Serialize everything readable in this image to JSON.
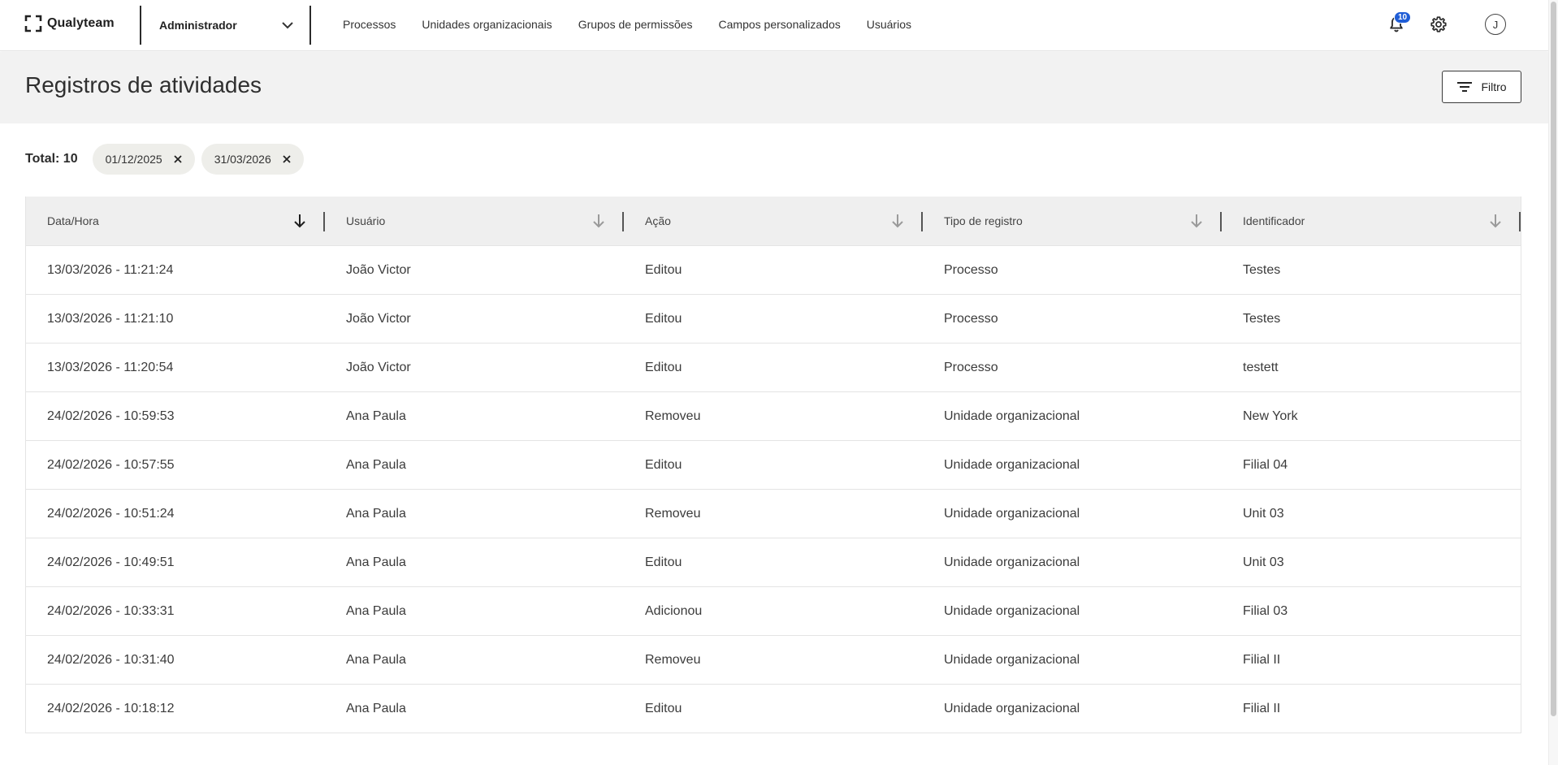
{
  "brand": {
    "name": "Qualyteam"
  },
  "role_select": {
    "value": "Administrador"
  },
  "nav": {
    "items": [
      {
        "label": "Processos"
      },
      {
        "label": "Unidades organizacionais"
      },
      {
        "label": "Grupos de permissões"
      },
      {
        "label": "Campos personalizados"
      },
      {
        "label": "Usuários"
      }
    ]
  },
  "notifications": {
    "count": "10",
    "icon": "bell-icon"
  },
  "settings": {
    "icon": "gear-icon"
  },
  "user": {
    "initial": "J"
  },
  "page": {
    "title": "Registros de atividades"
  },
  "filter_button": {
    "label": "Filtro"
  },
  "summary": {
    "total_label": "Total: 10"
  },
  "chips": [
    {
      "label": "01/12/2025"
    },
    {
      "label": "31/03/2026"
    }
  ],
  "table": {
    "columns": [
      {
        "label": "Data/Hora",
        "active_sort": true
      },
      {
        "label": "Usuário",
        "active_sort": false
      },
      {
        "label": "Ação",
        "active_sort": false
      },
      {
        "label": "Tipo de registro",
        "active_sort": false
      },
      {
        "label": "Identificador",
        "active_sort": false
      }
    ],
    "rows": [
      [
        "13/03/2026 - 11:21:24",
        "João Victor",
        "Editou",
        "Processo",
        "Testes"
      ],
      [
        "13/03/2026 - 11:21:10",
        "João Victor",
        "Editou",
        "Processo",
        "Testes"
      ],
      [
        "13/03/2026 - 11:20:54",
        "João Victor",
        "Editou",
        "Processo",
        "testett"
      ],
      [
        "24/02/2026 - 10:59:53",
        "Ana Paula",
        "Removeu",
        "Unidade organizacional",
        "New York"
      ],
      [
        "24/02/2026 - 10:57:55",
        "Ana Paula",
        "Editou",
        "Unidade organizacional",
        "Filial 04"
      ],
      [
        "24/02/2026 - 10:51:24",
        "Ana Paula",
        "Removeu",
        "Unidade organizacional",
        "Unit 03"
      ],
      [
        "24/02/2026 - 10:49:51",
        "Ana Paula",
        "Editou",
        "Unidade organizacional",
        "Unit 03"
      ],
      [
        "24/02/2026 - 10:33:31",
        "Ana Paula",
        "Adicionou",
        "Unidade organizacional",
        "Filial 03"
      ],
      [
        "24/02/2026 - 10:31:40",
        "Ana Paula",
        "Removeu",
        "Unidade organizacional",
        "Filial II"
      ],
      [
        "24/02/2026 - 10:18:12",
        "Ana Paula",
        "Editou",
        "Unidade organizacional",
        "Filial II"
      ]
    ]
  },
  "colors": {
    "badge": "#1f5dd6",
    "header_bg": "#f2f2f2",
    "table_header_bg": "#efefef",
    "chip_bg": "#eeeeea"
  }
}
